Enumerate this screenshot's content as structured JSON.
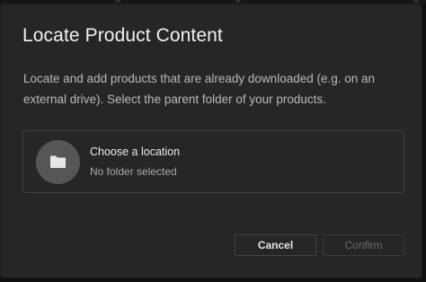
{
  "dialog": {
    "title": "Locate Product Content",
    "description": "Locate and add products that are already downloaded (e.g. on an external drive). Select the parent folder of your products.",
    "location": {
      "icon": "folder-icon",
      "title": "Choose a location",
      "status": "No folder selected"
    },
    "buttons": {
      "cancel": "Cancel",
      "confirm": "Confirm"
    }
  }
}
